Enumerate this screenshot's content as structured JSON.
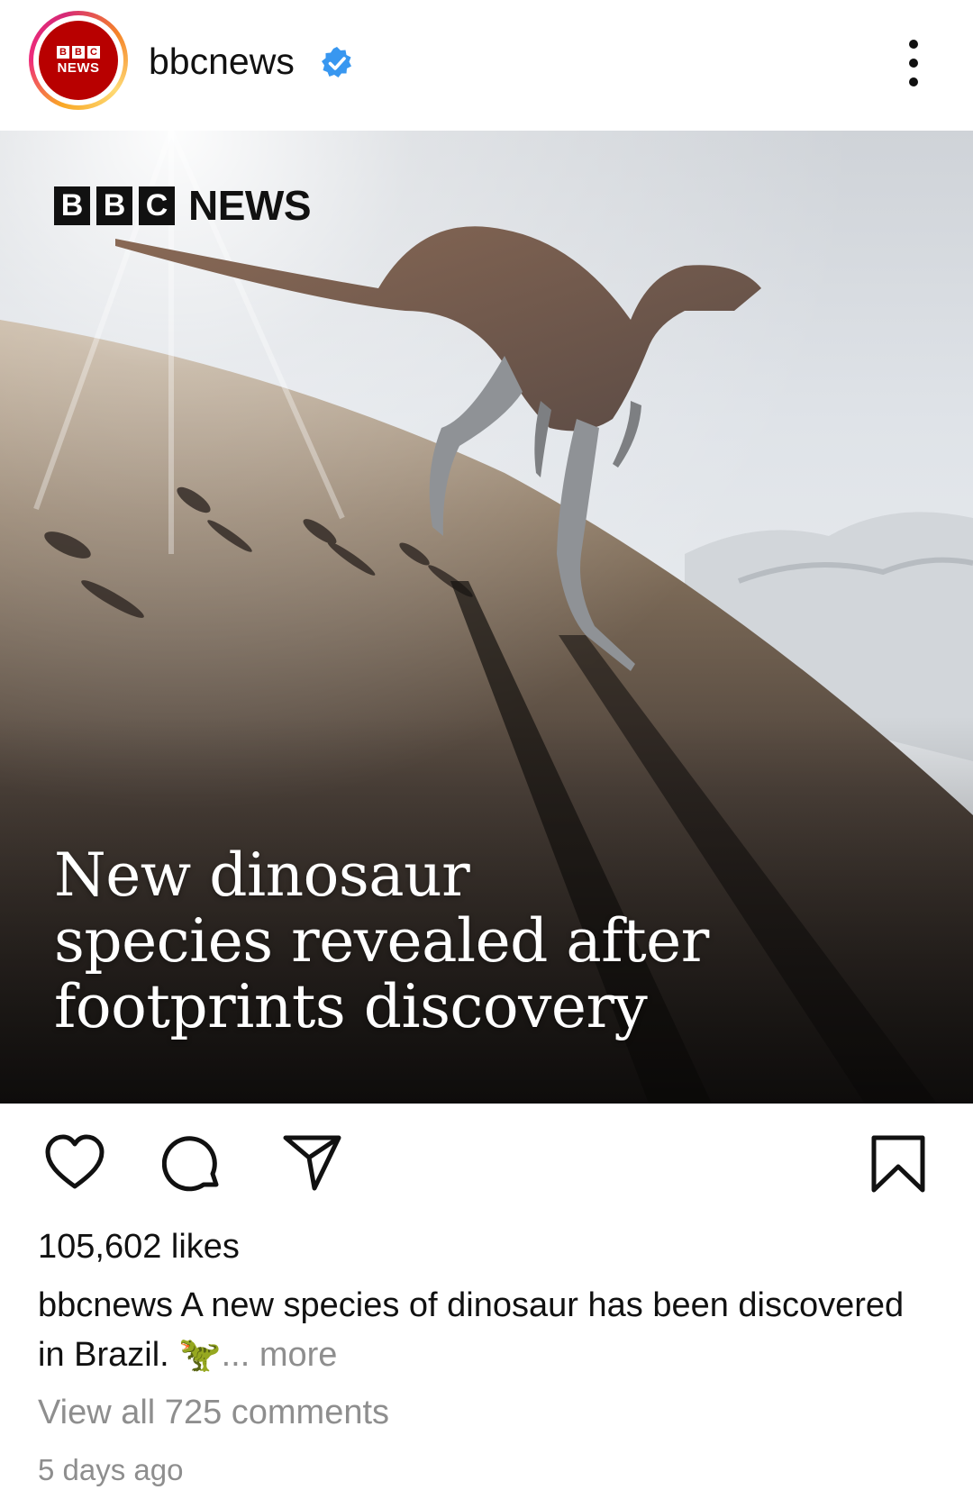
{
  "header": {
    "username": "bbcnews",
    "avatar": {
      "blocks": [
        "B",
        "B",
        "C"
      ],
      "label": "NEWS"
    },
    "verified_icon": "verified-badge-icon",
    "menu_icon": "more-vertical-icon"
  },
  "post": {
    "logo_blocks": [
      "B",
      "B",
      "C"
    ],
    "logo_text": "NEWS",
    "headline_lines": [
      "New dinosaur",
      "species revealed after",
      "footprints discovery"
    ]
  },
  "actions": {
    "like_icon": "heart-icon",
    "comment_icon": "comment-icon",
    "share_icon": "send-icon",
    "save_icon": "bookmark-icon"
  },
  "meta": {
    "likes": "105,602 likes",
    "caption_user": "bbcnews",
    "caption_text": " A new species of dinosaur has been discovered in Brazil. ",
    "caption_emoji": "🦖",
    "caption_ellipsis": "...",
    "caption_more": "more",
    "view_comments": "View all 725 comments",
    "timestamp": "5 days ago"
  },
  "colors": {
    "bbc_red": "#b80000",
    "verified_blue": "#3897f0",
    "secondary_text": "#8e8e8e",
    "primary_text": "#111111"
  }
}
